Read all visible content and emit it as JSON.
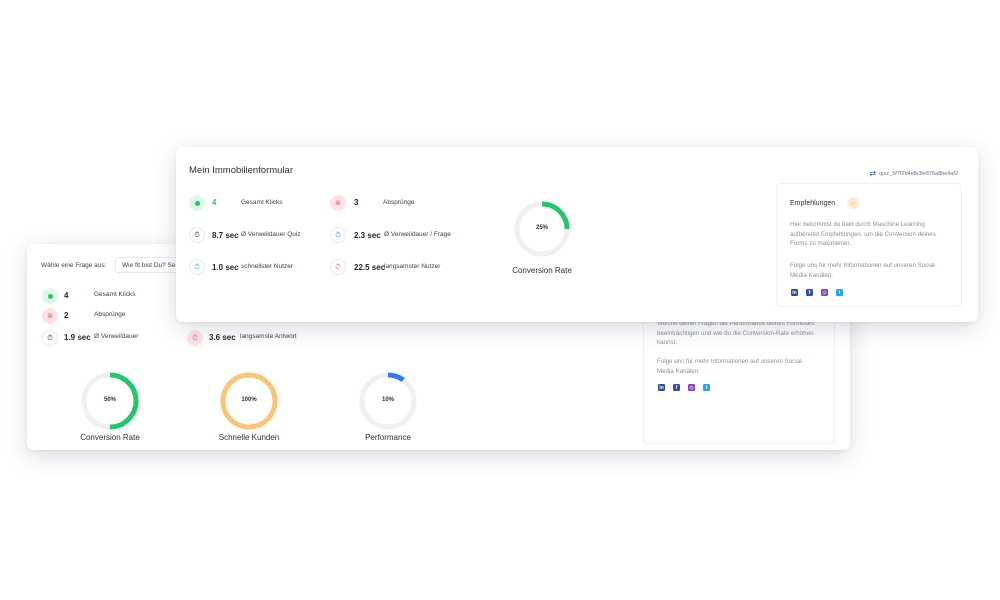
{
  "back": {
    "question_label": "Wähle eine Frage aus:",
    "question_value": "Wie fit bist Du? Se",
    "stats_left": [
      {
        "value": "4",
        "label": "Gesamt Klicks"
      },
      {
        "value": "2",
        "label": "Absprünge"
      },
      {
        "value": "1.9 sec",
        "label": "Ø Verweildauer"
      }
    ],
    "stats_mid": [
      {
        "value": "3.6 sec",
        "label": "langsamste Antwort"
      }
    ],
    "donuts": [
      {
        "center": "50%",
        "label": "Conversion Rate",
        "fraction": 0.5,
        "color": "#22c66b"
      },
      {
        "center": "100%",
        "label": "Schnelle Kunden",
        "fraction": 1.0,
        "color": "#f9c679"
      },
      {
        "center": "10%",
        "label": "Performance",
        "fraction": 0.1,
        "color": "#2f7bf3"
      }
    ],
    "reco_text_1": "Welche deiner Fragen die Performance deines Formulars beeinträchtigen und wie du die Conversion-Rate erhöhen kannst.",
    "reco_text_2": "Folge uns für mehr Informationen auf unseren Social-Media Kanälen."
  },
  "front": {
    "title": "Mein Immobilienformular",
    "quiz_id": "quiz_5f7f2b4efb3fe876a8be4af2",
    "stats": [
      {
        "value": "4",
        "label": "Gesamt Klicks",
        "kind": "green"
      },
      {
        "value": "3",
        "label": "Absprünge",
        "kind": "red"
      },
      {
        "value": "8.7 sec",
        "label": "Ø Verweildauer Quiz",
        "kind": "white"
      },
      {
        "value": "2.3 sec",
        "label": "Ø Verweildauer / Frage",
        "kind": "white"
      },
      {
        "value": "1.0 sec",
        "label": "schnellster Nutzer",
        "kind": "white"
      },
      {
        "value": "22.5 sec",
        "label": "langsamster Nutzer",
        "kind": "white"
      }
    ],
    "donut": {
      "center": "25%",
      "label": "Conversion Rate",
      "fraction": 0.25,
      "color": "#22c66b"
    },
    "reco": {
      "title": "Empfehlungen",
      "text_1": "Hier bekommst du bald durch Maschine Learning aufbereitet Empfehlungen, um die Conversion deines Forms zu maximieren.",
      "text_2": "Folge uns für mehr Informationen auf unseren Social-Media Kanälen."
    }
  },
  "icons": {
    "social": [
      "linkedin-icon",
      "facebook-icon",
      "instagram-icon",
      "twitter-icon"
    ]
  },
  "colors": {
    "green": "#22c66b",
    "red": "#ef5a6f",
    "orange": "#f9c679",
    "blue": "#2f7bf3"
  }
}
